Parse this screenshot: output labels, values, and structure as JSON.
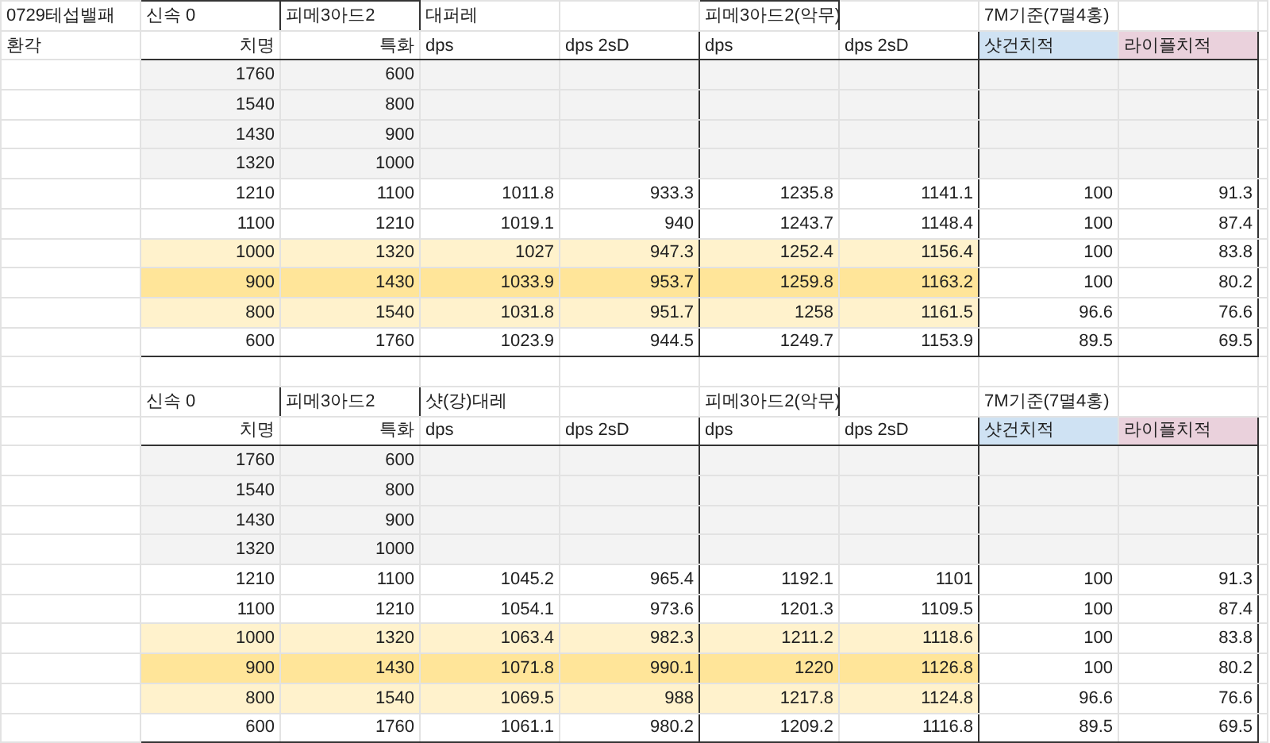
{
  "sheet": {
    "blocks": [
      {
        "side_labels": [
          "0729테섭밸패",
          "환각"
        ],
        "title_cells": [
          {
            "text": "신속 0",
            "boxed": true
          },
          {
            "text": "피메3아드2",
            "boxed": true
          },
          {
            "text": "대퍼레",
            "boxed": false
          },
          null,
          {
            "text": "피메3아드2(악무)",
            "boxed": true
          },
          null,
          {
            "text": "7M기준(7멸4홍)",
            "boxed": false
          },
          null
        ],
        "columns": [
          {
            "label": "치명"
          },
          {
            "label": "특화"
          },
          {
            "label": "dps"
          },
          {
            "label": "dps 2sD"
          },
          {
            "label": "dps"
          },
          {
            "label": "dps 2sD"
          },
          {
            "label": "샷건치적",
            "color": "#cfe2f3"
          },
          {
            "label": "라이플치적",
            "color": "#ead1dc"
          }
        ],
        "rows": [
          {
            "cells": [
              "1760",
              "600"
            ],
            "kind": "empty"
          },
          {
            "cells": [
              "1540",
              "800"
            ],
            "kind": "empty"
          },
          {
            "cells": [
              "1430",
              "900"
            ],
            "kind": "empty"
          },
          {
            "cells": [
              "1320",
              "1000"
            ],
            "kind": "empty"
          },
          {
            "cells": [
              "1210",
              "1100",
              "1011.8",
              "933.3",
              "1235.8",
              "1141.1",
              "100",
              "91.3"
            ],
            "kind": "plain"
          },
          {
            "cells": [
              "1100",
              "1210",
              "1019.1",
              "940",
              "1243.7",
              "1148.4",
              "100",
              "87.4"
            ],
            "kind": "plain"
          },
          {
            "cells": [
              "1000",
              "1320",
              "1027",
              "947.3",
              "1252.4",
              "1156.4",
              "100",
              "83.8"
            ],
            "kind": "highlighted"
          },
          {
            "cells": [
              "900",
              "1430",
              "1033.9",
              "953.7",
              "1259.8",
              "1163.2",
              "100",
              "80.2"
            ],
            "kind": "best"
          },
          {
            "cells": [
              "800",
              "1540",
              "1031.8",
              "951.7",
              "1258",
              "1161.5",
              "96.6",
              "76.6"
            ],
            "kind": "highlighted"
          },
          {
            "cells": [
              "600",
              "1760",
              "1023.9",
              "944.5",
              "1249.7",
              "1153.9",
              "89.5",
              "69.5"
            ],
            "kind": "plain"
          }
        ]
      },
      {
        "title_cells": [
          {
            "text": "신속 0",
            "boxed": true
          },
          {
            "text": "피메3아드2",
            "boxed": true
          },
          {
            "text": "샷(강)대레",
            "boxed": false
          },
          null,
          {
            "text": "피메3아드2(악무)",
            "boxed": true
          },
          null,
          {
            "text": "7M기준(7멸4홍)",
            "boxed": false
          },
          null
        ],
        "columns": [
          {
            "label": "치명"
          },
          {
            "label": "특화"
          },
          {
            "label": "dps"
          },
          {
            "label": "dps 2sD"
          },
          {
            "label": "dps"
          },
          {
            "label": "dps 2sD"
          },
          {
            "label": "샷건치적",
            "color": "#cfe2f3"
          },
          {
            "label": "라이플치적",
            "color": "#ead1dc"
          }
        ],
        "rows": [
          {
            "cells": [
              "1760",
              "600"
            ],
            "kind": "empty"
          },
          {
            "cells": [
              "1540",
              "800"
            ],
            "kind": "empty"
          },
          {
            "cells": [
              "1430",
              "900"
            ],
            "kind": "empty"
          },
          {
            "cells": [
              "1320",
              "1000"
            ],
            "kind": "empty"
          },
          {
            "cells": [
              "1210",
              "1100",
              "1045.2",
              "965.4",
              "1192.1",
              "1101",
              "100",
              "91.3"
            ],
            "kind": "plain"
          },
          {
            "cells": [
              "1100",
              "1210",
              "1054.1",
              "973.6",
              "1201.3",
              "1109.5",
              "100",
              "87.4"
            ],
            "kind": "plain"
          },
          {
            "cells": [
              "1000",
              "1320",
              "1063.4",
              "982.3",
              "1211.2",
              "1118.6",
              "100",
              "83.8"
            ],
            "kind": "highlighted"
          },
          {
            "cells": [
              "900",
              "1430",
              "1071.8",
              "990.1",
              "1220",
              "1126.8",
              "100",
              "80.2"
            ],
            "kind": "best"
          },
          {
            "cells": [
              "800",
              "1540",
              "1069.5",
              "988",
              "1217.8",
              "1124.8",
              "96.6",
              "76.6"
            ],
            "kind": "highlighted"
          },
          {
            "cells": [
              "600",
              "1760",
              "1061.1",
              "980.2",
              "1209.2",
              "1116.8",
              "89.5",
              "69.5"
            ],
            "kind": "plain"
          }
        ]
      }
    ]
  }
}
